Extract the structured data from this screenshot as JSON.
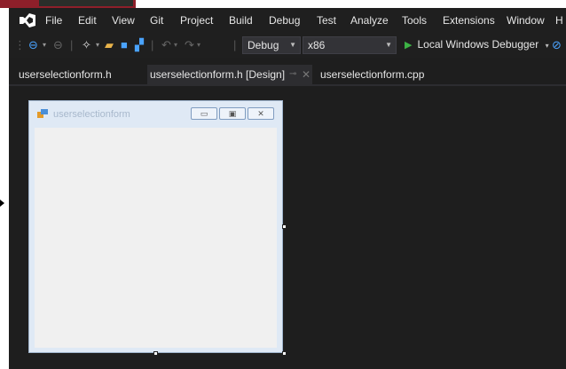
{
  "menu": [
    "File",
    "Edit",
    "View",
    "Git",
    "Project",
    "Build",
    "Debug",
    "Test",
    "Analyze",
    "Tools",
    "Extensions",
    "Window",
    "H"
  ],
  "toolbar": {
    "config": "Debug",
    "platform": "x86",
    "run_label": "Local Windows Debugger"
  },
  "tabs": [
    "userselectionform.h",
    "userselectionform.h [Design]",
    "userselectionform.cpp"
  ],
  "form": {
    "title": "userselectionform"
  },
  "colors": {
    "accent": "#3db345",
    "background": "#1e1e1e",
    "form_client": "#f0f0f0"
  }
}
